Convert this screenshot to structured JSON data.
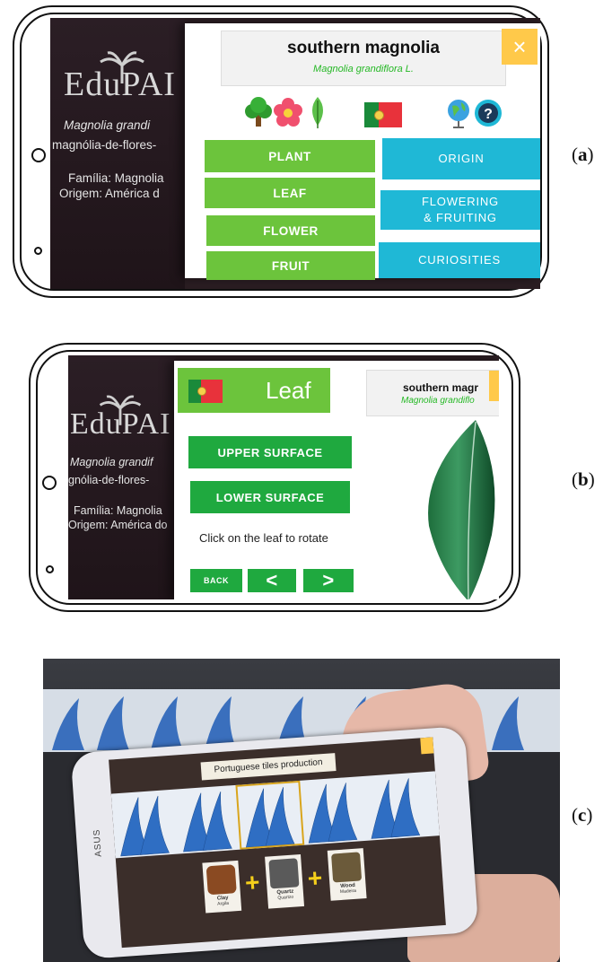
{
  "panels": {
    "a": {
      "label": "a",
      "poster": {
        "logo": "EduPAI",
        "lines": [
          "Magnolia grandi",
          "magnólia-de-flores-",
          "Família: Magnolia",
          "Origem: América d"
        ]
      },
      "app": {
        "common_name": "southern magnolia",
        "scientific_name": "Magnolia grandiflora L.",
        "close_icon": "×",
        "left_buttons": [
          "PLANT",
          "LEAF",
          "FLOWER",
          "FRUIT"
        ],
        "right_buttons": [
          "ORIGIN",
          "FLOWERING\n& FRUITING",
          "CURIOSITIES"
        ],
        "icons": [
          "tree-icon",
          "flower-icon",
          "leaf-icon",
          "portugal-flag-icon",
          "globe-icon",
          "help-icon"
        ],
        "colors": {
          "green": "#6cc43c",
          "blue": "#1fb8d6",
          "close": "#ffc94a"
        }
      }
    },
    "b": {
      "label": "b",
      "poster": {
        "logo": "EduPAI",
        "lines": [
          "Magnolia grandif",
          "gnólia-de-flores-",
          "Família: Magnolia",
          "Origem: América do"
        ]
      },
      "app": {
        "title": "Leaf",
        "side_common_name": "southern magr",
        "side_scientific_name": "Magnolia grandiflo",
        "buttons": [
          "UPPER SURFACE",
          "LOWER SURFACE"
        ],
        "hint": "Click on the leaf to rotate",
        "back_label": "BACK",
        "prev_label": "<",
        "next_label": ">"
      }
    },
    "c": {
      "label": "c",
      "app": {
        "title": "Portuguese tiles production",
        "ingredients": [
          {
            "name": "Clay",
            "caption": "Argila"
          },
          {
            "name": "Quartz",
            "caption": "Quartzo"
          },
          {
            "name": "Wood",
            "caption": "Madeira"
          }
        ],
        "plus": "+",
        "device_brand": "ASUS"
      }
    }
  }
}
